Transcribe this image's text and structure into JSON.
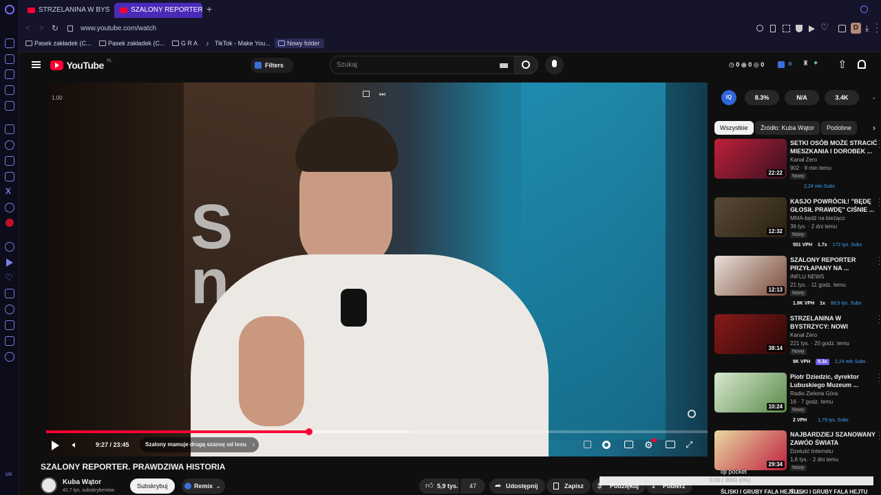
{
  "browser": {
    "tabs": [
      {
        "label": "STRZELANINA W BYSTRZ",
        "active": false
      },
      {
        "label": "SZALONY REPORTER. PR/",
        "active": true
      }
    ],
    "url": "www.youtube.com/watch",
    "bookmarks": [
      "Pasek zakładek (C...",
      "Pasek zakładek (C...",
      "G R A",
      "TikTok - Make You...",
      "Nowy folder"
    ],
    "profile_letter": "D"
  },
  "youtube": {
    "logo": "YouTube",
    "region": "PL",
    "filters_label": "Filters",
    "search_placeholder": "Szukaj",
    "counters": [
      "0",
      "0",
      "0"
    ]
  },
  "player": {
    "top_left_label": "1.00",
    "time": "9:27 / 23:45",
    "chapter": "Szalony mamuje drugą szansę od losu",
    "progress": 0.398,
    "buffered": 0.55
  },
  "video": {
    "title": "SZALONY REPORTER. PRAWDZIWA HISTORIA",
    "channel": "Kuba Wątor",
    "subscribers": "42,7 tys. subskrybentów",
    "subscribe_label": "Subskrybuj",
    "remix_label": "Remix",
    "likes": "5,9 tys.",
    "comments": "47",
    "share_label": "Udostępnij",
    "save_label": "Zapisz",
    "thanks_label": "Podziękuj",
    "download_label": "Pobierz"
  },
  "sidebar": {
    "stats": [
      "8.3%",
      "N/A",
      "3.4K"
    ],
    "chips": [
      "Wszystkie",
      "Źródło: Kuba Wątor",
      "Podobne"
    ],
    "videos": [
      {
        "title": "SETKI OSÓB MOŻE STRACIĆ MIESZKANIA I DOROBEK ...",
        "channel": "Kanał Zero",
        "meta": "902 · 9 min temu",
        "duration": "22:22",
        "badge": "Nowy",
        "stats": [
          "",
          "",
          "2,24 mln Subs"
        ]
      },
      {
        "title": "KASJO POWRÓCIŁ! \"BĘDĘ GŁOSIŁ PRAWDĘ\" CIŚNIE ...",
        "channel": "MMA-będź na bieżąco",
        "meta": "36 tys. · 2 dni temu",
        "duration": "12:32",
        "badge": "Nowy",
        "stats": [
          "501 VPH",
          "1.7x",
          "172 tys. Subs"
        ]
      },
      {
        "title": "SZALONY REPORTER PRZYŁAPANY NA ...",
        "channel": "INFLU NEWS",
        "meta": "21 tys. · 11 godz. temu",
        "duration": "12:13",
        "badge": "Nowy",
        "stats": [
          "1.9K VPH",
          "1x",
          "88,5 tys. Subs"
        ]
      },
      {
        "title": "STRZELANINA W BYSTRZYCY: NOWI ŚWIADKOWIE. CO WIE ...",
        "channel": "Kanał Zero",
        "meta": "221 tys. · 20 godz. temu",
        "duration": "38:14",
        "badge": "Nowy",
        "stats": [
          "9K VPH",
          "5.3x",
          "2,24 mln Subs"
        ]
      },
      {
        "title": "Piotr Dziedzic, dyrektor Lubuskiego Muzeum ...",
        "channel": "Radio Zielona Góra",
        "meta": "16 · 7 godz. temu",
        "duration": "10:24",
        "badge": "Nowy",
        "stats": [
          "2 VPH",
          "",
          "1,79 tys. Subs"
        ]
      },
      {
        "title": "NAJBARDZIEJ SZANOWANY ZAWÓD ŚWIATA",
        "channel": "Dzeluść Internetu",
        "meta": "1,6 tys. · 2 dni temu",
        "duration": "29:34",
        "badge": "Nowy",
        "stats": [
          "",
          "",
          ""
        ]
      }
    ],
    "footer_titles": [
      "ŚLISKI I GRUBY FALA HEJTU...",
      "ŚLISKI I GRUBY FALA HEJTU"
    ]
  },
  "overlay": {
    "label": "dji pocket",
    "counter": "0.00 / 3000 (0%)"
  },
  "colors": {
    "accent": "#ff0033",
    "browser_accent": "#4a2bb8",
    "vph_blue": "#3ea6ff",
    "ratio_purple": "#6c5ce7"
  }
}
